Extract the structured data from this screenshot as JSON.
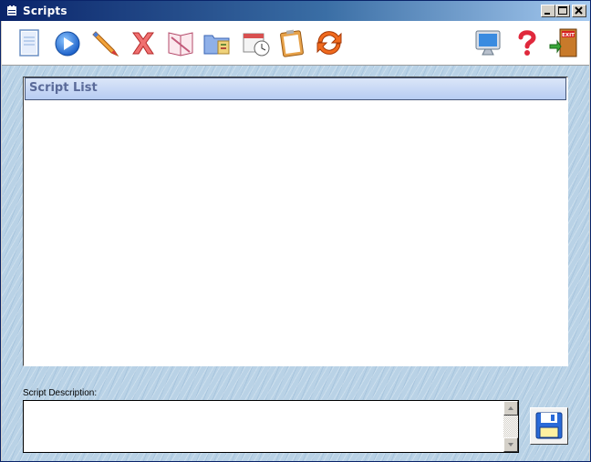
{
  "window": {
    "title": "Scripts"
  },
  "toolbar": {
    "icons": [
      "new-document-icon",
      "run-icon",
      "edit-icon",
      "delete-icon",
      "book-icon",
      "folder-tools-icon",
      "schedule-icon",
      "clipboard-icon",
      "refresh-icon",
      "monitor-icon",
      "help-icon",
      "exit-icon"
    ],
    "exit_sign": "EXIT"
  },
  "script_list": {
    "header": "Script List",
    "rows": []
  },
  "description": {
    "label": "Script Description:",
    "value": ""
  },
  "colors": {
    "title_start": "#0a246a",
    "title_end": "#a6caf0",
    "list_header_text": "#5a6a99",
    "background": "#b9d2e6"
  }
}
